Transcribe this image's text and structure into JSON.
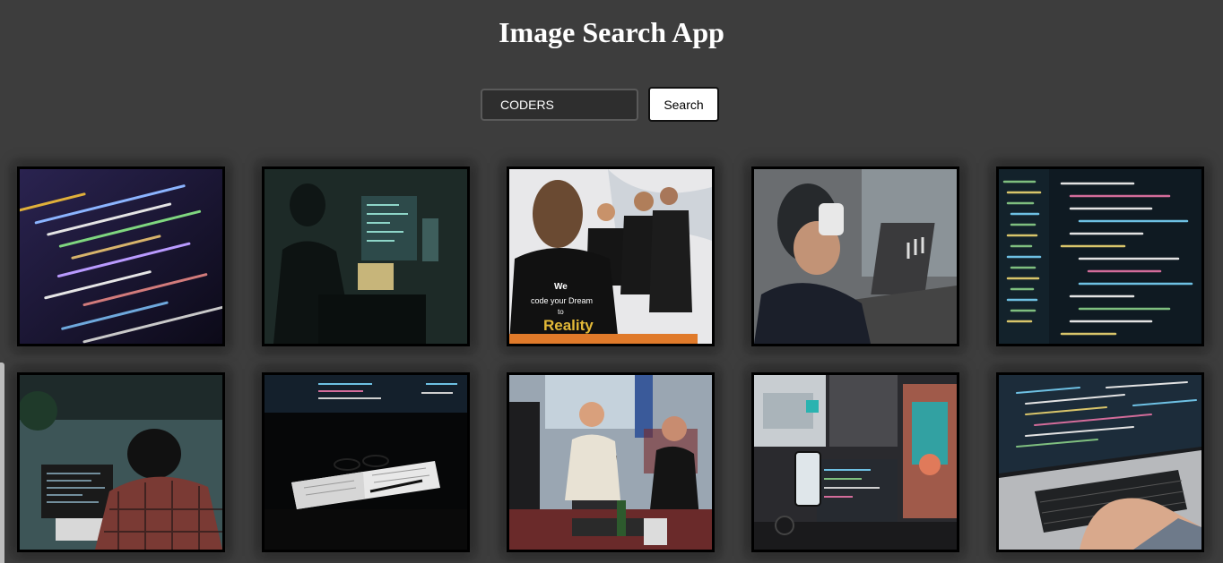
{
  "app": {
    "title": "Image Search App"
  },
  "search": {
    "value": "CODERS",
    "button_label": "Search"
  },
  "results": [
    {
      "name": "result-code-screen-closeup"
    },
    {
      "name": "result-coder-dark-room-monitors"
    },
    {
      "name": "result-team-we-code-your-dream"
    },
    {
      "name": "result-man-drinking-at-laptop"
    },
    {
      "name": "result-code-editor-screen"
    },
    {
      "name": "result-coder-plaid-shirt"
    },
    {
      "name": "result-notebook-glasses-desk"
    },
    {
      "name": "result-two-men-office-computers"
    },
    {
      "name": "result-phone-monitors-workspace"
    },
    {
      "name": "result-hands-typing-laptop"
    }
  ],
  "results_caption": {
    "shirt_line1": "We",
    "shirt_line2": "code your Dream",
    "shirt_line3": "to",
    "shirt_line4": "Reality"
  }
}
